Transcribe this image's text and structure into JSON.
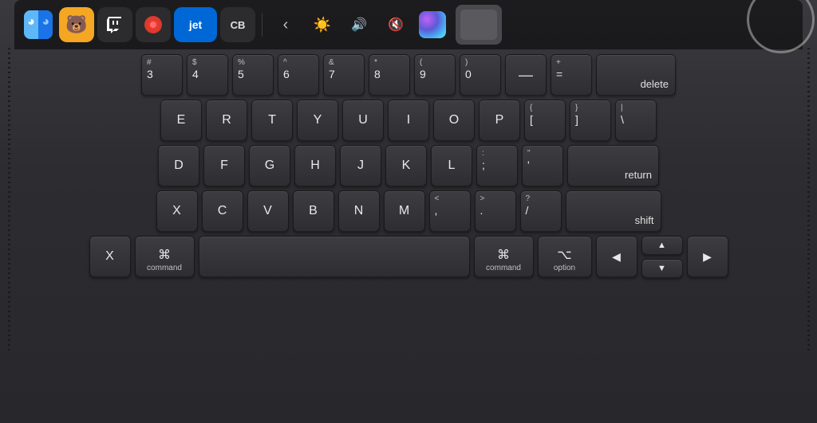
{
  "touchbar": {
    "apps": [
      {
        "id": "finder",
        "label": "Finder",
        "icon": "finder"
      },
      {
        "id": "bear",
        "label": "Bear",
        "icon": "🐻"
      },
      {
        "id": "twitch",
        "label": "Twitch",
        "icon": "⊕"
      },
      {
        "id": "screenium",
        "label": "Screenium",
        "icon": "⏺"
      },
      {
        "id": "jet",
        "label": "jet",
        "icon": "jet"
      },
      {
        "id": "codeshot",
        "label": "CodeShot",
        "icon": "CB"
      }
    ],
    "controls": [
      {
        "id": "brightness-down",
        "label": "‹",
        "icon": "◂"
      },
      {
        "id": "brightness",
        "label": "☀",
        "icon": "☀"
      },
      {
        "id": "volume",
        "label": "🔊",
        "icon": "volume"
      },
      {
        "id": "mute",
        "label": "🔇",
        "icon": "mute"
      },
      {
        "id": "siri",
        "label": "Siri",
        "icon": "siri"
      }
    ]
  },
  "keyboard": {
    "rows": [
      {
        "id": "number-row",
        "keys": [
          {
            "top": "#",
            "main": "3",
            "id": "3"
          },
          {
            "top": "$",
            "main": "4",
            "id": "4"
          },
          {
            "top": "%",
            "main": "5",
            "id": "5"
          },
          {
            "top": "^",
            "main": "6",
            "id": "6"
          },
          {
            "top": "&",
            "main": "7",
            "id": "7"
          },
          {
            "top": "*",
            "main": "8",
            "id": "8"
          },
          {
            "top": "(",
            "main": "9",
            "id": "9"
          },
          {
            "top": ")",
            "main": "0",
            "id": "0"
          },
          {
            "top": "_",
            "main": "—",
            "id": "minus"
          },
          {
            "top": "+",
            "main": "=",
            "id": "equals"
          },
          {
            "top": "",
            "main": "delete",
            "id": "delete",
            "wide": true
          }
        ]
      },
      {
        "id": "qwerty-row",
        "keys": [
          {
            "top": "",
            "main": "E",
            "id": "e"
          },
          {
            "top": "",
            "main": "R",
            "id": "r"
          },
          {
            "top": "",
            "main": "T",
            "id": "t"
          },
          {
            "top": "",
            "main": "Y",
            "id": "y"
          },
          {
            "top": "",
            "main": "U",
            "id": "u"
          },
          {
            "top": "",
            "main": "I",
            "id": "i"
          },
          {
            "top": "",
            "main": "O",
            "id": "o"
          },
          {
            "top": "",
            "main": "P",
            "id": "p"
          },
          {
            "top": "{",
            "main": "[",
            "id": "open-bracket"
          },
          {
            "top": "}",
            "main": "]",
            "id": "close-bracket"
          },
          {
            "top": "|",
            "main": "\\",
            "id": "backslash"
          }
        ]
      },
      {
        "id": "asdf-row",
        "keys": [
          {
            "top": "",
            "main": "D",
            "id": "d"
          },
          {
            "top": "",
            "main": "F",
            "id": "f"
          },
          {
            "top": "",
            "main": "G",
            "id": "g"
          },
          {
            "top": "",
            "main": "H",
            "id": "h"
          },
          {
            "top": "",
            "main": "J",
            "id": "j"
          },
          {
            "top": "",
            "main": "K",
            "id": "k"
          },
          {
            "top": "",
            "main": "L",
            "id": "l"
          },
          {
            "top": ":",
            "main": ";",
            "id": "semicolon"
          },
          {
            "top": "\"",
            "main": "'",
            "id": "quote"
          },
          {
            "top": "",
            "main": "return",
            "id": "return",
            "wide": true
          }
        ]
      },
      {
        "id": "zxcv-row",
        "keys": [
          {
            "top": "",
            "main": "X",
            "id": "x"
          },
          {
            "top": "",
            "main": "C",
            "id": "c"
          },
          {
            "top": "",
            "main": "V",
            "id": "v"
          },
          {
            "top": "",
            "main": "B",
            "id": "b"
          },
          {
            "top": "",
            "main": "N",
            "id": "n"
          },
          {
            "top": "",
            "main": "M",
            "id": "m"
          },
          {
            "top": "<",
            "main": ",",
            "id": "comma"
          },
          {
            "top": ">",
            "main": ".",
            "id": "period"
          },
          {
            "top": "?",
            "main": "/",
            "id": "slash"
          },
          {
            "top": "",
            "main": "shift",
            "id": "right-shift",
            "wide": true
          }
        ]
      },
      {
        "id": "bottom-row",
        "keys": [
          {
            "top": "",
            "main": "⌘",
            "sub": "command",
            "id": "left-cmd"
          },
          {
            "top": "",
            "main": "space",
            "id": "space",
            "space": true
          },
          {
            "top": "",
            "main": "⌘",
            "sub": "command",
            "id": "right-cmd"
          },
          {
            "top": "",
            "main": "⌥",
            "sub": "option",
            "id": "option"
          },
          {
            "top": "",
            "main": "◀",
            "id": "left"
          },
          {
            "top": "",
            "main": "▲",
            "id": "up"
          },
          {
            "top": "",
            "main": "▼",
            "id": "down"
          },
          {
            "top": "",
            "main": "▶",
            "id": "right"
          }
        ]
      }
    ]
  }
}
